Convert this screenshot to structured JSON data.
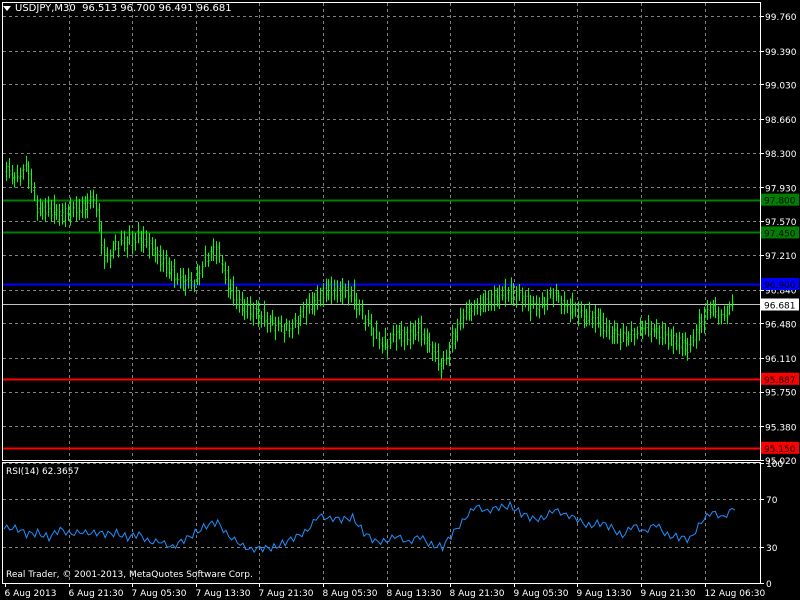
{
  "header": {
    "symbol_tf": "USDJPY,M30",
    "ohlc": "96.513 96.700 96.491 96.681"
  },
  "rsi_panel": {
    "title": "RSI(14) 62.3657",
    "levels": [
      "100",
      "70",
      "30",
      "0"
    ]
  },
  "copyright": "Real Trader, © 2001-2013, MetaQuotes Software Corp.",
  "colors": {
    "background": "#000000",
    "grid": "#808080",
    "candles": "#00ff00",
    "rsi_line": "#1e90ff",
    "support_green": "#008000",
    "pivot_blue": "#0000ff",
    "resistance_red": "#ff0000"
  },
  "chart_data": [
    {
      "type": "candlestick",
      "symbol": "USDJPY",
      "timeframe": "M30",
      "ylim": [
        95.02,
        99.9
      ],
      "y_ticks": [
        "99.760",
        "99.390",
        "99.030",
        "98.660",
        "98.300",
        "97.930",
        "97.570",
        "97.210",
        "96.840",
        "96.480",
        "96.110",
        "95.750",
        "95.380",
        "95.020"
      ],
      "x_ticks": [
        "6 Aug 2013",
        "6 Aug 21:30",
        "7 Aug 05:30",
        "7 Aug 13:30",
        "7 Aug 21:30",
        "8 Aug 05:30",
        "8 Aug 13:30",
        "8 Aug 21:30",
        "9 Aug 05:30",
        "9 Aug 13:30",
        "9 Aug 21:30",
        "12 Aug 06:30"
      ],
      "current_price": "96.681",
      "horizontal_lines": [
        {
          "value": 97.8,
          "label": "97.800",
          "color": "#008000"
        },
        {
          "value": 97.45,
          "label": "97.450",
          "color": "#008000"
        },
        {
          "value": 96.9,
          "label": "96.900",
          "color": "#0000ff"
        },
        {
          "value": 95.887,
          "label": "95.887",
          "color": "#ff0000"
        },
        {
          "value": 95.15,
          "label": "95.150",
          "color": "#ff0000"
        }
      ],
      "close_series": [
        98.1,
        98.08,
        98.12,
        97.7,
        97.72,
        97.62,
        97.68,
        97.74,
        97.78,
        97.2,
        97.3,
        97.35,
        97.42,
        97.3,
        97.15,
        97.05,
        96.88,
        96.95,
        97.18,
        97.25,
        96.9,
        96.68,
        96.6,
        96.58,
        96.45,
        96.42,
        96.5,
        96.62,
        96.78,
        96.84,
        96.8,
        96.82,
        96.55,
        96.35,
        96.28,
        96.33,
        96.36,
        96.42,
        96.22,
        96.02,
        96.32,
        96.55,
        96.7,
        96.68,
        96.78,
        96.82,
        96.76,
        96.66,
        96.72,
        96.75,
        96.72,
        96.58,
        96.56,
        96.52,
        96.38,
        96.32,
        96.4,
        96.38,
        96.45,
        96.32,
        96.28,
        96.22,
        96.48,
        96.62,
        96.6,
        96.64
      ]
    },
    {
      "type": "line",
      "name": "RSI(14) 62.3657",
      "ylim": [
        0,
        100
      ],
      "levels": [
        30,
        70
      ],
      "values": [
        45,
        47,
        40,
        42,
        38,
        44,
        42,
        41,
        43,
        40,
        42,
        38,
        40,
        35,
        33,
        31,
        35,
        42,
        48,
        50,
        40,
        31,
        29,
        28,
        30,
        34,
        38,
        45,
        55,
        55,
        52,
        55,
        42,
        34,
        36,
        38,
        35,
        38,
        32,
        30,
        42,
        55,
        63,
        61,
        62,
        65,
        58,
        53,
        55,
        60,
        58,
        52,
        48,
        50,
        46,
        40,
        47,
        44,
        48,
        40,
        38,
        36,
        52,
        58,
        56,
        62
      ]
    }
  ]
}
